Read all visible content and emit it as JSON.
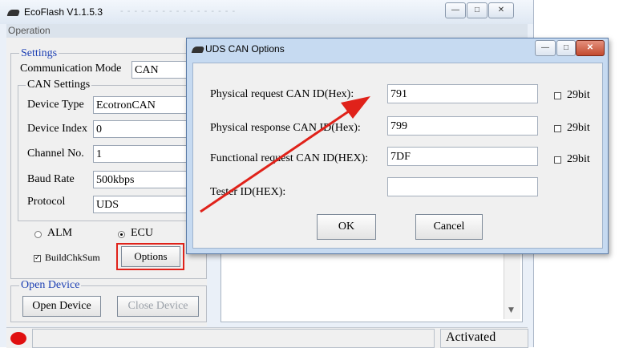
{
  "app": {
    "title": "EcoFlash V1.1.5.3",
    "ghost_text": "- - - -  - -  - - - -     - - - - - - -",
    "menu": "Operation",
    "window_buttons": {
      "minimize": "—",
      "maximize": "□",
      "close": "✕"
    }
  },
  "settings": {
    "group_label": "Settings",
    "comm_mode_label": "Communication Mode",
    "comm_mode_value": "CAN",
    "can_group_label": "CAN Settings",
    "device_type_label": "Device Type",
    "device_type_value": "EcotronCAN",
    "device_index_label": "Device Index",
    "device_index_value": "0",
    "channel_label": "Channel No.",
    "channel_value": "1",
    "baud_label": "Baud Rate",
    "baud_value": "500kbps",
    "protocol_label": "Protocol",
    "protocol_value": "UDS",
    "radio_alm": "ALM",
    "radio_ecu": "ECU",
    "buildchk_label": "BuildChkSum",
    "options_button": "Options"
  },
  "open_device": {
    "group_label": "Open Device",
    "open_button": "Open Device",
    "close_button": "Close Device"
  },
  "status": {
    "state": "Activated"
  },
  "dialog": {
    "title": "UDS CAN Options",
    "phys_req_label": "Physical request CAN ID(Hex):",
    "phys_req_value": "791",
    "phys_resp_label": "Physical response CAN ID(Hex):",
    "phys_resp_value": "799",
    "func_req_label": "Functional request CAN ID(HEX):",
    "func_req_value": "7DF",
    "tester_label": "Tester ID(HEX):",
    "tester_value": "",
    "bit29_label": "29bit",
    "ok_button": "OK",
    "cancel_button": "Cancel"
  },
  "colors": {
    "highlight": "#e0221a",
    "group_label_blue": "#1c3fb3",
    "status_dot": "#e01010"
  }
}
